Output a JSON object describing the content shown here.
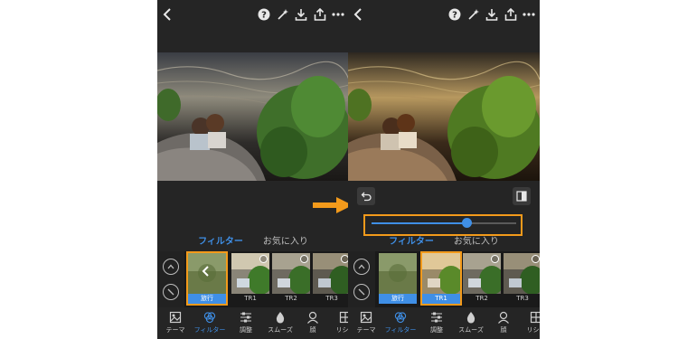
{
  "left": {
    "tabs": {
      "filter": "フィルター",
      "favorites": "お気に入り"
    },
    "thumbs": [
      {
        "label": "旅行",
        "selected": true
      },
      {
        "label": "TR1",
        "selected": false
      },
      {
        "label": "TR2",
        "selected": false
      },
      {
        "label": "TR3",
        "selected": false
      }
    ]
  },
  "right": {
    "tabs": {
      "filter": "フィルター",
      "favorites": "お気に入り"
    },
    "slider": {
      "value_fraction": 0.66
    },
    "thumbs": [
      {
        "label": "旅行",
        "selected": false
      },
      {
        "label": "TR1",
        "selected": true
      },
      {
        "label": "TR2",
        "selected": false
      },
      {
        "label": "TR3",
        "selected": false
      }
    ]
  },
  "nav": {
    "theme": "テーマ",
    "filter": "フィルター",
    "adjust": "調整",
    "smooth": "スムーズ",
    "face": "顔",
    "reshape": "リシェ"
  },
  "colors": {
    "accent": "#3f8fe6",
    "highlight": "#f39a1b",
    "panel": "#252525"
  },
  "icons": [
    "back-icon",
    "help-icon",
    "magic-wand-icon",
    "download-icon",
    "share-icon",
    "more-icon",
    "undo-icon",
    "compare-icon",
    "chevron-up-icon",
    "no-filter-icon",
    "chevron-left-icon",
    "heart-icon",
    "theme-icon",
    "filter-icon",
    "adjust-icon",
    "drop-icon",
    "face-icon",
    "reshape-icon"
  ]
}
